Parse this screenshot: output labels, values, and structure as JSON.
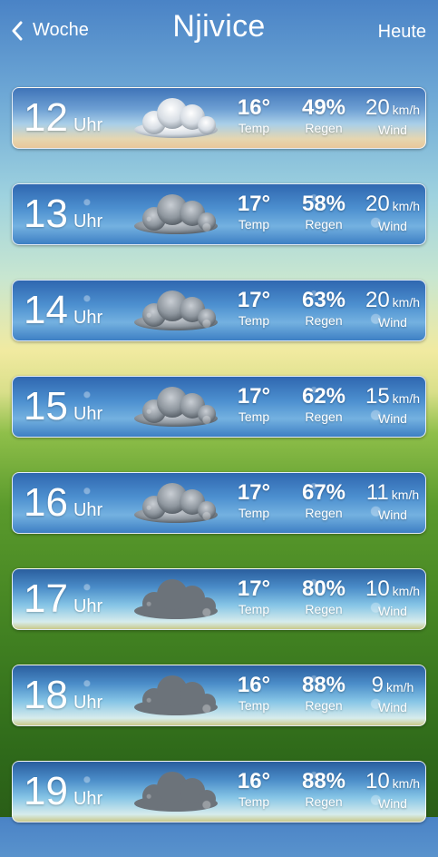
{
  "header": {
    "back_label": "Woche",
    "title": "Njivice",
    "today_label": "Heute"
  },
  "labels": {
    "unit_hour": "Uhr",
    "temp": "Temp",
    "rain": "Regen",
    "wind": "Wind",
    "wind_unit": "km/h"
  },
  "rows": [
    {
      "hour": "12",
      "temp": "16°",
      "rain": "49%",
      "wind": "20",
      "sky": "sunny"
    },
    {
      "hour": "13",
      "temp": "17°",
      "rain": "58%",
      "wind": "20",
      "sky": "cloudy"
    },
    {
      "hour": "14",
      "temp": "17°",
      "rain": "63%",
      "wind": "20",
      "sky": "cloudy"
    },
    {
      "hour": "15",
      "temp": "17°",
      "rain": "62%",
      "wind": "15",
      "sky": "cloudy"
    },
    {
      "hour": "16",
      "temp": "17°",
      "rain": "67%",
      "wind": "11",
      "sky": "cloudy"
    },
    {
      "hour": "17",
      "temp": "17°",
      "rain": "80%",
      "wind": "10",
      "sky": "rainy"
    },
    {
      "hour": "18",
      "temp": "16°",
      "rain": "88%",
      "wind": "9",
      "sky": "rainy"
    },
    {
      "hour": "19",
      "temp": "16°",
      "rain": "88%",
      "wind": "10",
      "sky": "rainy"
    }
  ]
}
